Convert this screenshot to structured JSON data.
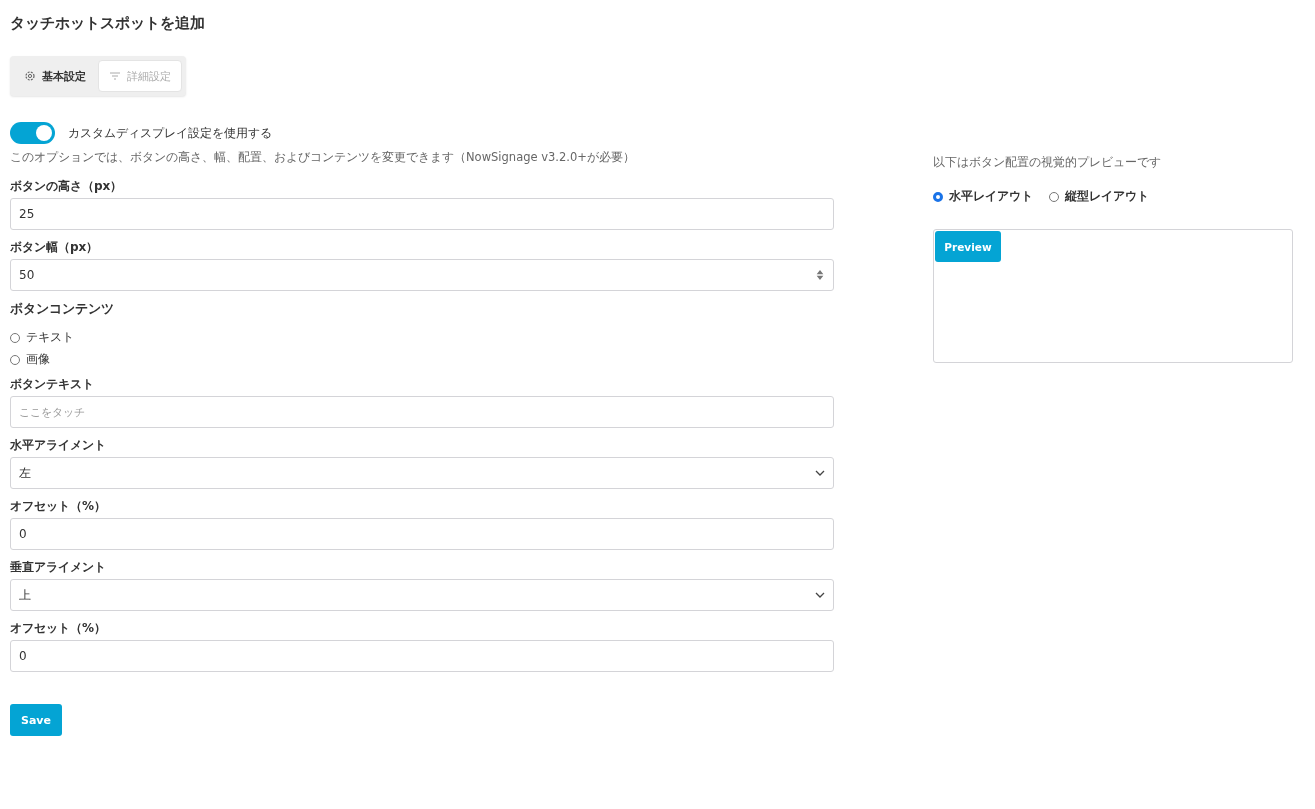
{
  "title": "タッチホットスポットを追加",
  "tabs": [
    {
      "label": "基本設定",
      "selected": true
    },
    {
      "label": "詳細設定",
      "selected": false
    }
  ],
  "toggle": {
    "label": "カスタムディスプレイ設定を使用する",
    "on": true
  },
  "description": "このオプションでは、ボタンの高さ、幅、配置、およびコンテンツを変更できます（NowSignage v3.2.0+が必要）",
  "fields": [
    {
      "kind": "text",
      "label": "ボタンの高さ（px）",
      "value": "25"
    },
    {
      "kind": "number",
      "label": "ボタン幅（px）",
      "value": "50"
    },
    {
      "kind": "radios",
      "label": "ボタンコンテンツ",
      "options": [
        {
          "label": "テキスト",
          "selected": false
        },
        {
          "label": "画像",
          "selected": false
        }
      ]
    },
    {
      "kind": "text",
      "label": "ボタンテキスト",
      "placeholder": "ここをタッチ"
    },
    {
      "kind": "select",
      "label": "水平アライメント",
      "value": "左"
    },
    {
      "kind": "text",
      "label": "オフセット（%）",
      "value": "0"
    },
    {
      "kind": "select",
      "label": "垂直アライメント",
      "value": "上"
    },
    {
      "kind": "text",
      "label": "オフセット（%）",
      "value": "0"
    }
  ],
  "save_button": "Save",
  "preview": {
    "caption": "以下はボタン配置の視覚的プレビューです",
    "layouts": [
      {
        "label": "水平レイアウト",
        "selected": true
      },
      {
        "label": "縦型レイアウト",
        "selected": false
      }
    ],
    "button": "Preview"
  }
}
